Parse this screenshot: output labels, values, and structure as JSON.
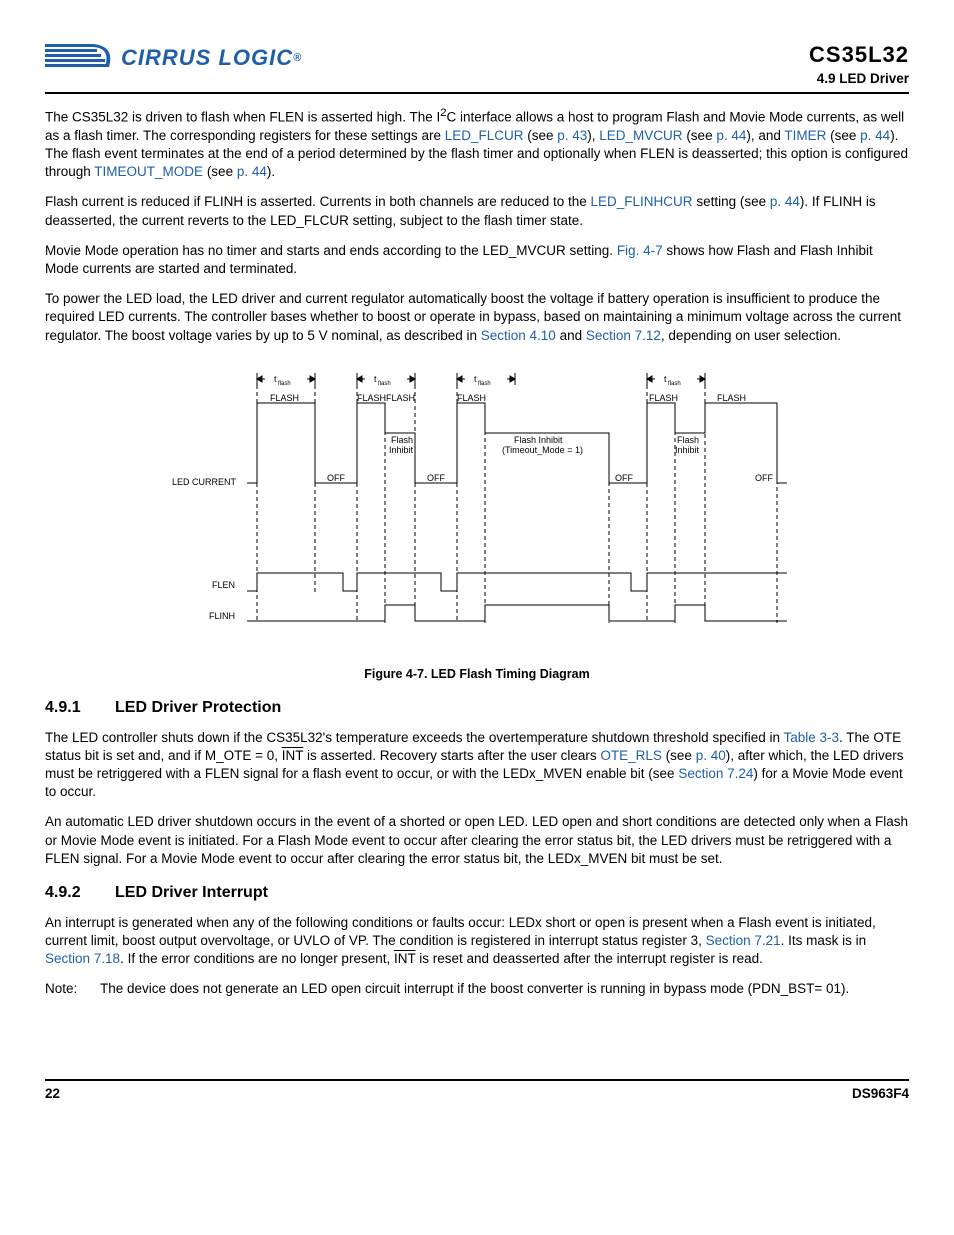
{
  "header": {
    "logo_text": "CIRRUS LOGIC",
    "logo_reg": "®",
    "doc_title": "CS35L32",
    "doc_sub": "4.9 LED Driver"
  },
  "para1": {
    "t1": "The CS35L32 is driven to flash when FLEN is asserted high. The I",
    "sup": "2",
    "t2": "C interface allows a host to program Flash and Movie Mode currents, as well as a flash timer. The corresponding registers for these settings are ",
    "l1": "LED_FLCUR",
    "t3": " (see ",
    "l2": "p. 43",
    "t4": "), ",
    "l3": "LED_MVCUR",
    "t5": " (see ",
    "l4": "p. 44",
    "t6": "), and ",
    "l5": "TIMER",
    "t7": " (see ",
    "l6": "p. 44",
    "t8": "). The flash event terminates at the end of a period determined by the flash timer and optionally when FLEN is deasserted; this option is configured through ",
    "l7": "TIMEOUT_MODE",
    "t9": " (see ",
    "l8": "p. 44",
    "t10": ")."
  },
  "para2": {
    "t1": "Flash current is reduced if FLINH is asserted. Currents in both channels are reduced to the ",
    "l1": "LED_FLINHCUR",
    "t2": " setting (see ",
    "l2": "p. 44",
    "t3": "). If FLINH is deasserted, the current reverts to the LED_FLCUR setting, subject to the flash timer state."
  },
  "para3": {
    "t1": "Movie Mode operation has no timer and starts and ends according to the LED_MVCUR setting. ",
    "l1": "Fig. 4-7",
    "t2": " shows how Flash and Flash Inhibit Mode currents are started and terminated."
  },
  "para4": {
    "t1": "To power the LED load, the LED driver and current regulator automatically boost the voltage if battery operation is insufficient to produce the required LED currents. The controller bases whether to boost or operate in bypass, based on maintaining a minimum voltage across the current regulator. The boost voltage varies by up to 5 V nominal, as described in ",
    "l1": "Section 4.10",
    "t2": " and ",
    "l2": "Section 7.12",
    "t3": ", depending on user selection."
  },
  "diagram": {
    "tflash": "t",
    "tflash_sub": "flash",
    "FLASH": "FLASH",
    "FlashInhibit": "Flash",
    "FlashInhibit2": "Inhibit",
    "FlashInhibitTO1": "Flash Inhibit",
    "FlashInhibitTO2": "(Timeout_Mode = 1)",
    "OFF": "OFF",
    "LEDCURRENT": "LED CURRENT",
    "FLEN": "FLEN",
    "FLINH": "FLINH",
    "caption": "Figure 4-7. LED Flash Timing Diagram"
  },
  "sec491": {
    "num": "4.9.1",
    "title": "LED Driver Protection",
    "p1a": "The LED controller shuts down if the CS35L32's temperature exceeds the overtemperature shutdown threshold specified in ",
    "p1l1": "Table 3-3",
    "p1b": ". The OTE status bit is set and, and if M_OTE = 0, ",
    "p1int": "INT",
    "p1c": " is asserted. Recovery starts after the user clears ",
    "p1l2": "OTE_RLS",
    "p1d": " (see ",
    "p1l3": "p. 40",
    "p1e": "), after which, the LED drivers must be retriggered with a FLEN signal for a flash event to occur, or with the LEDx_MVEN enable bit (see ",
    "p1l4": "Section 7.24",
    "p1f": ") for a Movie Mode event to occur.",
    "p2": "An automatic LED driver shutdown occurs in the event of a shorted or open LED. LED open and short conditions are detected only when a Flash or Movie Mode event is initiated. For a Flash Mode event to occur after clearing the error status bit, the LED drivers must be retriggered with a FLEN signal. For a Movie Mode event to occur after clearing the error status bit, the LEDx_MVEN bit must be set."
  },
  "sec492": {
    "num": "4.9.2",
    "title": "LED Driver Interrupt",
    "p1a": "An interrupt is generated when any of the following conditions or faults occur: LEDx short or open is present when a Flash event is initiated, current limit, boost output overvoltage, or UVLO of VP. The condition is registered in interrupt status register 3, ",
    "p1l1": "Section 7.21",
    "p1b": ". Its mask is in ",
    "p1l2": "Section 7.18",
    "p1c": ". If the error conditions are no longer present, ",
    "p1int": "INT",
    "p1d": " is reset and deasserted after the interrupt register is read.",
    "note_lbl": "Note:",
    "note_txt": "The device does not generate an LED open circuit interrupt if the boost converter is running in bypass mode (PDN_BST= 01)."
  },
  "footer": {
    "page": "22",
    "docnum": "DS963F4"
  }
}
